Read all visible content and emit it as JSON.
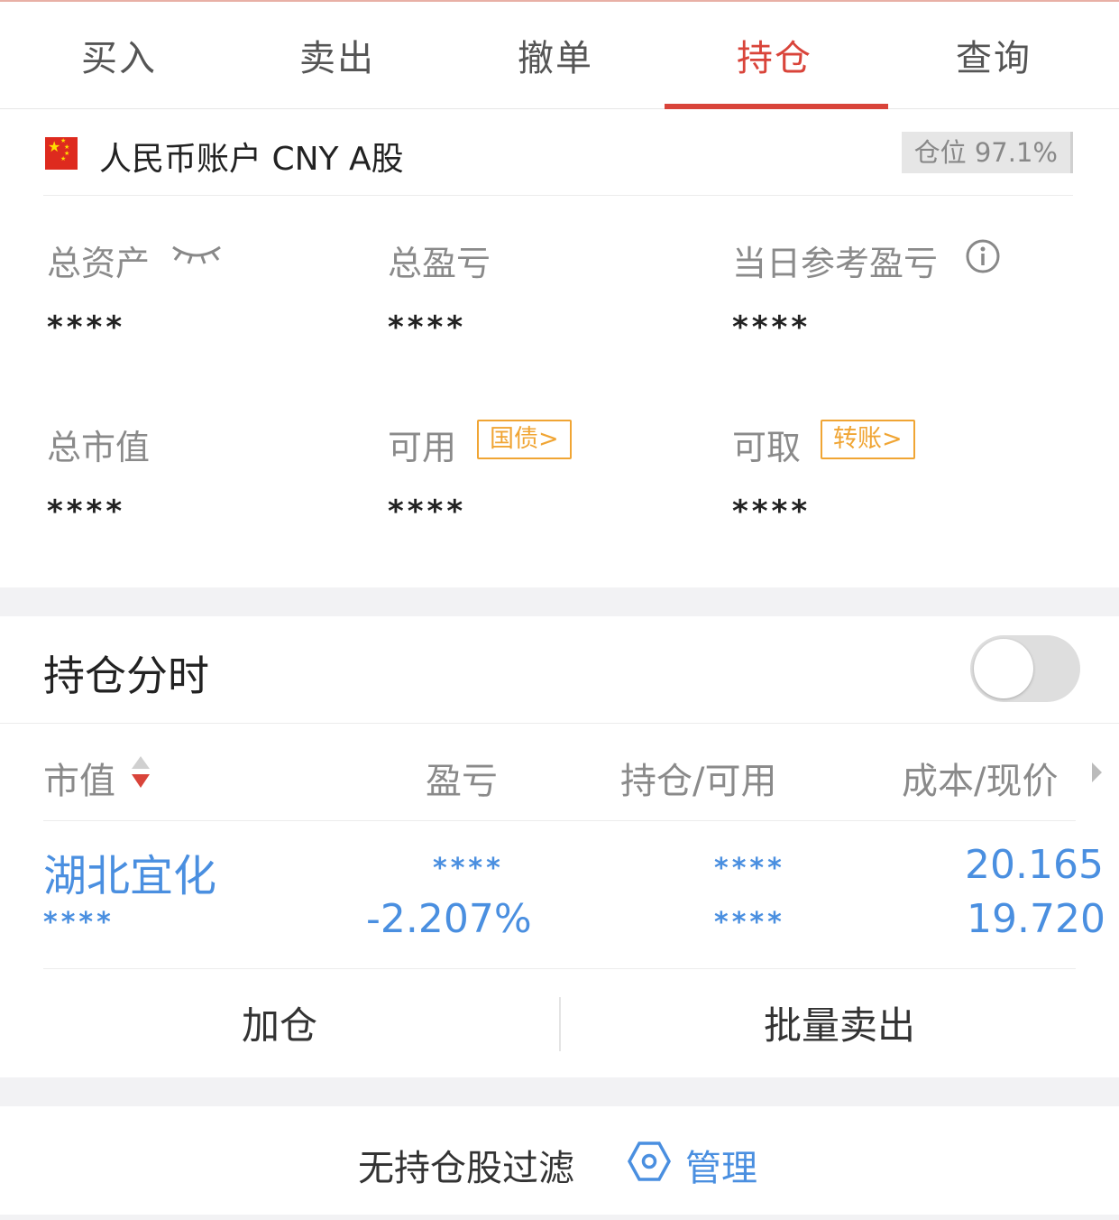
{
  "tabs": [
    {
      "label": "买入"
    },
    {
      "label": "卖出"
    },
    {
      "label": "撤单"
    },
    {
      "label": "持仓",
      "active": true
    },
    {
      "label": "查询"
    }
  ],
  "account": {
    "title": "人民币账户 CNY A股",
    "flag_icon": "china-flag-icon",
    "position_badge": "仓位 97.1%",
    "metrics": {
      "total_assets": {
        "label": "总资产",
        "value": "****"
      },
      "total_pnl": {
        "label": "总盈亏",
        "value": "****"
      },
      "daily_pnl": {
        "label": "当日参考盈亏",
        "value": "****"
      },
      "market_value": {
        "label": "总市值",
        "value": "****"
      },
      "available": {
        "label": "可用",
        "value": "****",
        "tag": "国债>"
      },
      "withdrawable": {
        "label": "可取",
        "value": "****",
        "tag": "转账>"
      }
    }
  },
  "holdings": {
    "title": "持仓分时",
    "toggle_on": false,
    "columns": {
      "market_value": "市值",
      "pnl": "盈亏",
      "holding_available": "持仓/可用",
      "cost_price": "成本/现价"
    },
    "rows": [
      {
        "name": "湖北宜化",
        "market_value": "****",
        "pnl_amount": "****",
        "pnl_percent": "-2.207%",
        "holding": "****",
        "available": "****",
        "cost": "20.165",
        "price": "19.720"
      }
    ],
    "actions": {
      "add": "加仓",
      "batch_sell": "批量卖出"
    }
  },
  "filter": {
    "text": "无持仓股过滤",
    "manage": "管理"
  },
  "colors": {
    "accent_red": "#d9443a",
    "link_blue": "#4a8fe0",
    "tag_orange": "#f0a534"
  }
}
